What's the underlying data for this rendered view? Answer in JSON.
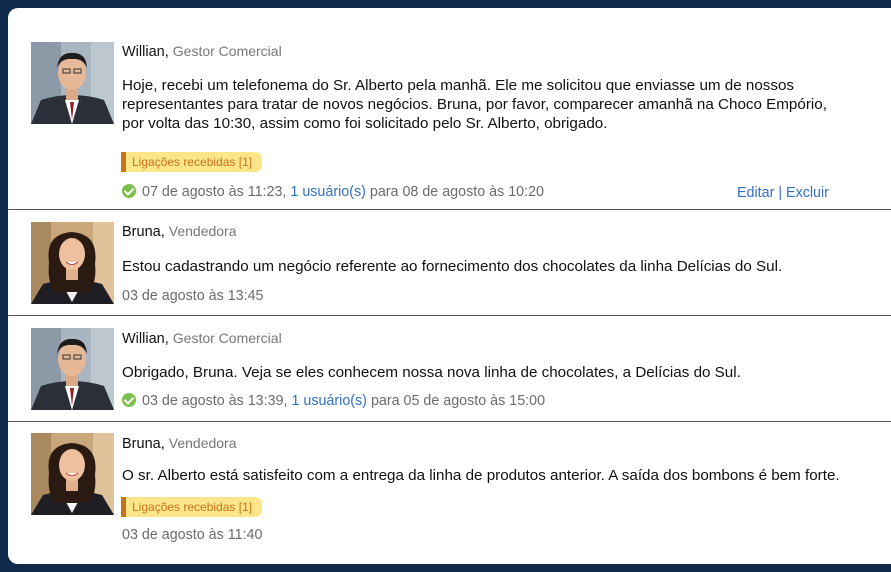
{
  "posts": [
    {
      "author": "Willian,",
      "role": "Gestor Comercial",
      "lines": [
        "Hoje, recebi um telefonema do Sr. Alberto pela manhã. Ele me solicitou que enviasse um de nossos",
        "representantes para tratar de novos negócios. Bruna, por favor, comparecer amanhã na Choco Empório,",
        "por volta das 10:30, assim como foi solicitado pelo Sr. Alberto, obrigado."
      ],
      "tag": "Ligações recebidas [1]",
      "date": "07 de agosto às 11:23,",
      "users_link": "1 usuário(s)",
      "due": "para 08 de agosto às 10:20",
      "edit": "Editar",
      "sep": "|",
      "delete": "Excluir"
    },
    {
      "author": "Bruna,",
      "role": "Vendedora",
      "lines": [
        "Estou cadastrando um negócio referente ao fornecimento dos chocolates da linha Delícias do Sul."
      ],
      "date": "03 de agosto às 13:45"
    },
    {
      "author": "Willian,",
      "role": "Gestor Comercial",
      "lines": [
        "Obrigado, Bruna. Veja se eles conhecem nossa nova linha de chocolates, a Delícias do Sul."
      ],
      "date": "03 de agosto às 13:39,",
      "users_link": "1 usuário(s)",
      "due": "para 05 de agosto às 15:00"
    },
    {
      "author": "Bruna,",
      "role": "Vendedora",
      "lines": [
        "O sr. Alberto está satisfeito com a entrega da linha de produtos anterior. A saída dos bombons é bem forte."
      ],
      "tag": "Ligações recebidas [1]",
      "date": "03 de agosto às 11:40"
    }
  ],
  "colors": {
    "background": "#0e2a4a",
    "link": "#3470c4",
    "tag_bg": "#fde58a",
    "tag_accent": "#c8741a",
    "check": "#7ac04a"
  },
  "icons": [
    "check-circle-icon"
  ]
}
